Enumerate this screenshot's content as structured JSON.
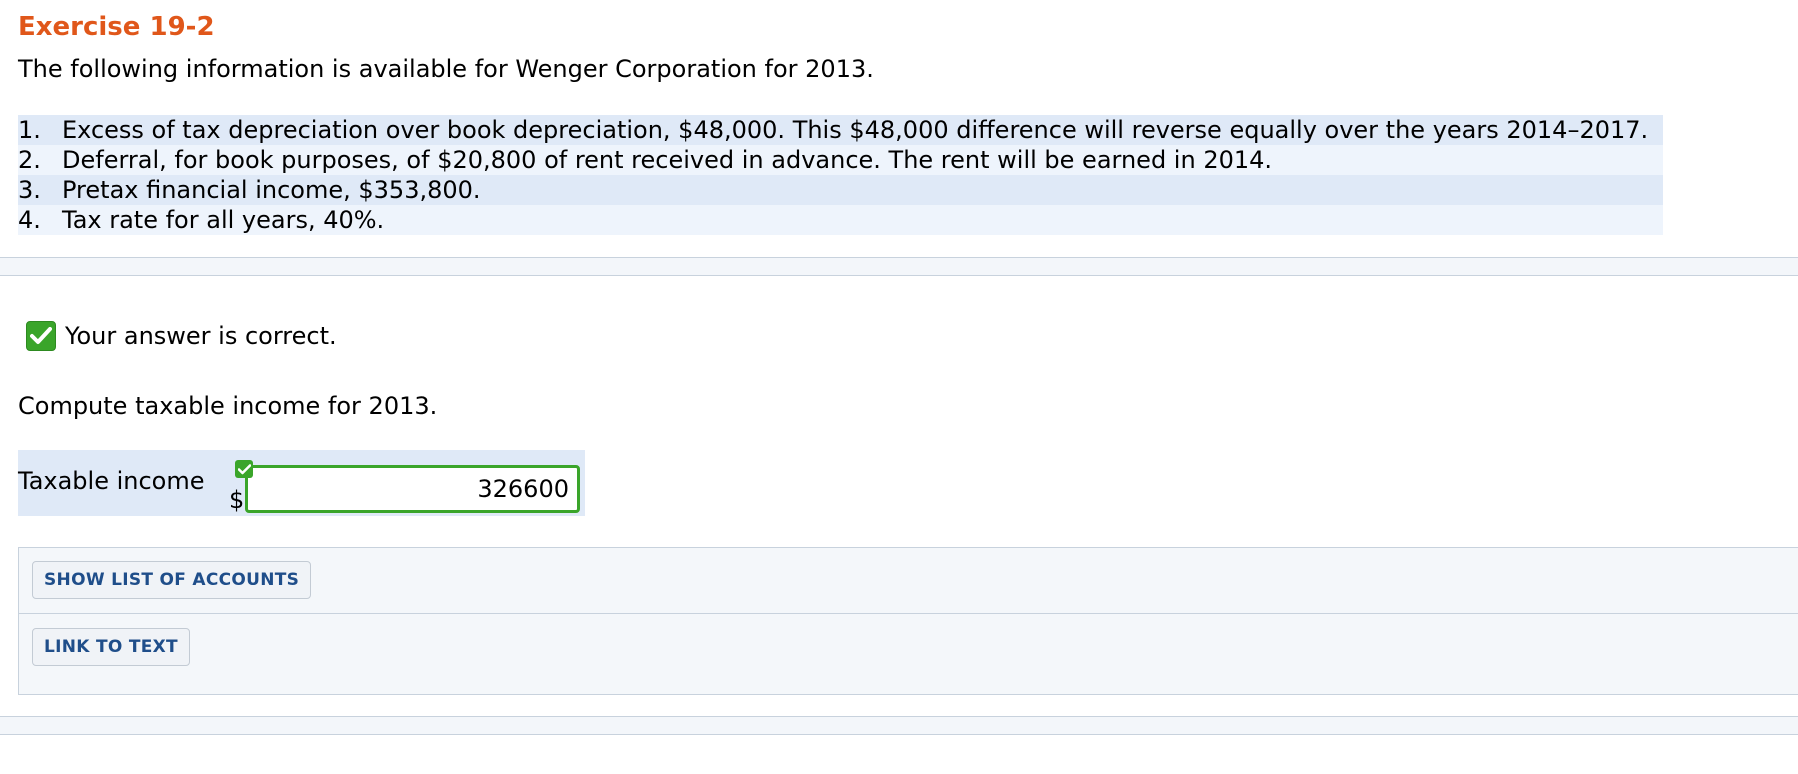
{
  "exercise": {
    "title": "Exercise 19-2",
    "intro": "The following information is available for Wenger Corporation for 2013.",
    "items": [
      {
        "num": "1.",
        "text": "Excess of tax depreciation over book depreciation, $48,000. This $48,000 difference will reverse equally over the years 2014–2017."
      },
      {
        "num": "2.",
        "text": "Deferral, for book purposes, of $20,800 of rent received in advance. The rent will be earned in 2014."
      },
      {
        "num": "3.",
        "text": "Pretax financial income, $353,800."
      },
      {
        "num": "4.",
        "text": "Tax rate for all years, 40%."
      }
    ]
  },
  "feedback": {
    "icon": "check-icon",
    "message": "Your answer is correct.",
    "color": "#3aa52a"
  },
  "question": {
    "prompt": "Compute taxable income for 2013.",
    "answer_label": "Taxable income",
    "currency_symbol": "$",
    "answer_value": "326600"
  },
  "tools": {
    "show_accounts_label": "SHOW LIST OF ACCOUNTS",
    "link_to_text_label": "LINK TO TEXT"
  },
  "colors": {
    "title": "#e0571a",
    "accent_green": "#3aa52a",
    "row_shade": "#dfe9f7",
    "button_text": "#1f4e8a"
  }
}
